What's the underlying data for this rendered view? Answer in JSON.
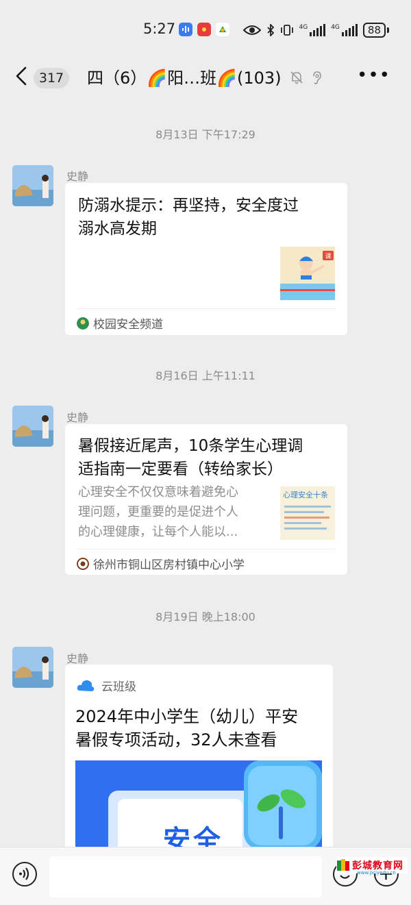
{
  "status": {
    "time": "5:27",
    "net_label_1": "4G",
    "net_label_2": "4G",
    "battery": "88"
  },
  "header": {
    "unread_count": "317",
    "title": "四（6）🌈阳…班🌈(103)"
  },
  "messages": [
    {
      "timestamp": "8月13日 下午17:29",
      "sender": "史静",
      "title_line1": "防溺水提示：再坚持，安全度过",
      "title_line2": "溺水高发期",
      "source": "校园安全频道",
      "thumb_icon": "swimming-cartoon-thumbnail",
      "thumb_badge": "课"
    },
    {
      "timestamp": "8月16日 上午11:11",
      "sender": "史静",
      "title_line1": "暑假接近尾声，10条学生心理调",
      "title_line2": "适指南一定要看（转给家长）",
      "desc_line1": "心理安全不仅仅意味着避免心",
      "desc_line2": "理问题，更重要的是促进个人",
      "desc_line3": "的心理健康，让每个人能以...",
      "thumb_text": "心理安全十条",
      "source": "徐州市铜山区房村镇中心小学"
    },
    {
      "timestamp": "8月19日 晚上18:00",
      "sender": "史静",
      "app_name": "云班级",
      "title_line1": "2024年中小学生（幼儿）平安",
      "title_line2": "暑假专项活动，32人未查看",
      "banner_text": "安全"
    }
  ],
  "watermark": {
    "name": "彭城教育网",
    "url": "www.pcjyedu.cn"
  },
  "colors": {
    "background": "#ededed",
    "card": "#ffffff",
    "meta_text": "#8c8c8c",
    "banner_blue": "#2f6ff0",
    "app_icon_blue": "#2e8ef0"
  },
  "icons": {
    "back": "chevron-left-icon",
    "mute": "bell-off-icon",
    "ear": "earpiece-icon",
    "more": "more-horizontal-icon",
    "voice": "voice-icon",
    "emoji": "emoji-icon",
    "add": "plus-icon"
  }
}
